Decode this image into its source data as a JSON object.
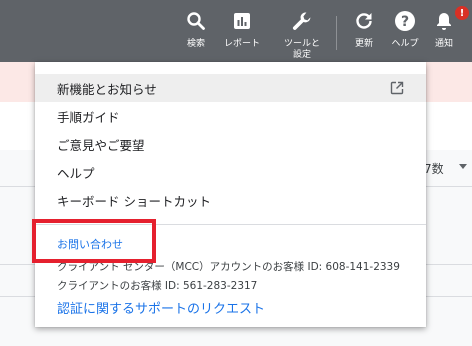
{
  "toolbar": {
    "search_label": "検索",
    "reports_label": "レポート",
    "tools_label": "ツールと",
    "tools_label_line2": "設定",
    "refresh_label": "更新",
    "help_label": "ヘルプ",
    "notifications_label": "通知",
    "notification_badge": "!"
  },
  "background": {
    "column_text": "7数"
  },
  "help_menu": {
    "items": [
      {
        "label": "新機能とお知らせ"
      },
      {
        "label": "手順ガイド"
      },
      {
        "label": "ご意見やご要望"
      },
      {
        "label": "ヘルプ"
      },
      {
        "label": "キーボード ショートカット"
      }
    ],
    "contact_link": "お問い合わせ",
    "mcc_info": "クライアント センター（MCC）アカウントのお客様 ID: 608-141-2339",
    "client_info": "クライアントのお客様 ID: 561-283-2317",
    "support_link": "認証に関するサポートのリクエスト"
  },
  "colors": {
    "toolbar_bg": "#5f6368",
    "link": "#1a73e8",
    "highlight": "#e5202e",
    "badge": "#d93025"
  }
}
